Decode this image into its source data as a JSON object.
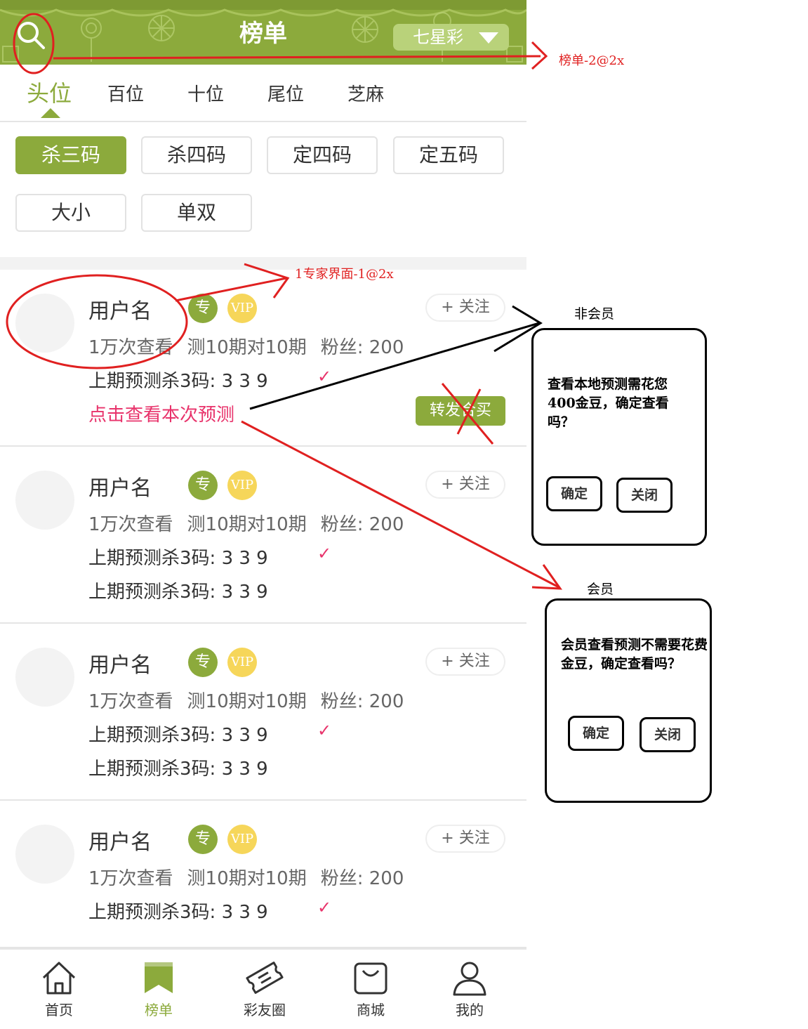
{
  "header": {
    "title": "榜单",
    "lottery_select": "七星彩"
  },
  "tabs": [
    "头位",
    "百位",
    "十位",
    "尾位",
    "芝麻"
  ],
  "filters": [
    "杀三码",
    "杀四码",
    "定四码",
    "定五码",
    "大小",
    "单双"
  ],
  "cards": [
    {
      "username": "用户名",
      "badge_expert": "专",
      "badge_vip": "VIP",
      "follow": "+ 关注",
      "views": "1万次查看",
      "record": "测10期对10期",
      "fans": "粉丝: 200",
      "predictions": [
        "上期预测杀3码: 3 3 9"
      ],
      "check": "✓",
      "view_link": "点击查看本次预测",
      "forward": "转发合买"
    },
    {
      "username": "用户名",
      "badge_expert": "专",
      "badge_vip": "VIP",
      "follow": "+ 关注",
      "views": "1万次查看",
      "record": "测10期对10期",
      "fans": "粉丝: 200",
      "predictions": [
        "上期预测杀3码: 3 3 9",
        "上期预测杀3码: 3 3 9"
      ],
      "check": "✓"
    },
    {
      "username": "用户名",
      "badge_expert": "专",
      "badge_vip": "VIP",
      "follow": "+ 关注",
      "views": "1万次查看",
      "record": "测10期对10期",
      "fans": "粉丝: 200",
      "predictions": [
        "上期预测杀3码: 3 3 9",
        "上期预测杀3码: 3 3 9"
      ],
      "check": "✓"
    },
    {
      "username": "用户名",
      "badge_expert": "专",
      "badge_vip": "VIP",
      "follow": "+ 关注",
      "views": "1万次查看",
      "record": "测10期对10期",
      "fans": "粉丝: 200",
      "predictions": [
        "上期预测杀3码: 3 3 9"
      ],
      "check": "✓"
    }
  ],
  "bottom_nav": [
    {
      "label": "首页",
      "icon": "home-icon"
    },
    {
      "label": "榜单",
      "icon": "bookmark-icon"
    },
    {
      "label": "彩友圈",
      "icon": "ticket-icon"
    },
    {
      "label": "商城",
      "icon": "shopping-bag-icon"
    },
    {
      "label": "我的",
      "icon": "user-icon"
    }
  ],
  "annotations": {
    "search_target": "榜单-2@2x",
    "user_target": "1专家界面-1@2x",
    "non_member_label": "非会员",
    "member_label": "会员"
  },
  "dialog_non_member": {
    "message": "查看本地预测需花您400金豆，确定查看吗？",
    "confirm": "确定",
    "close": "关闭"
  },
  "dialog_member": {
    "message": "会员查看预测不需要花费金豆，确定查看吗？",
    "confirm": "确定",
    "close": "关闭"
  },
  "colors": {
    "brand_green": "#8caa3c",
    "accent_pink": "#e8336b",
    "vip_yellow": "#f6d65a",
    "annotation_red": "#e02020"
  }
}
